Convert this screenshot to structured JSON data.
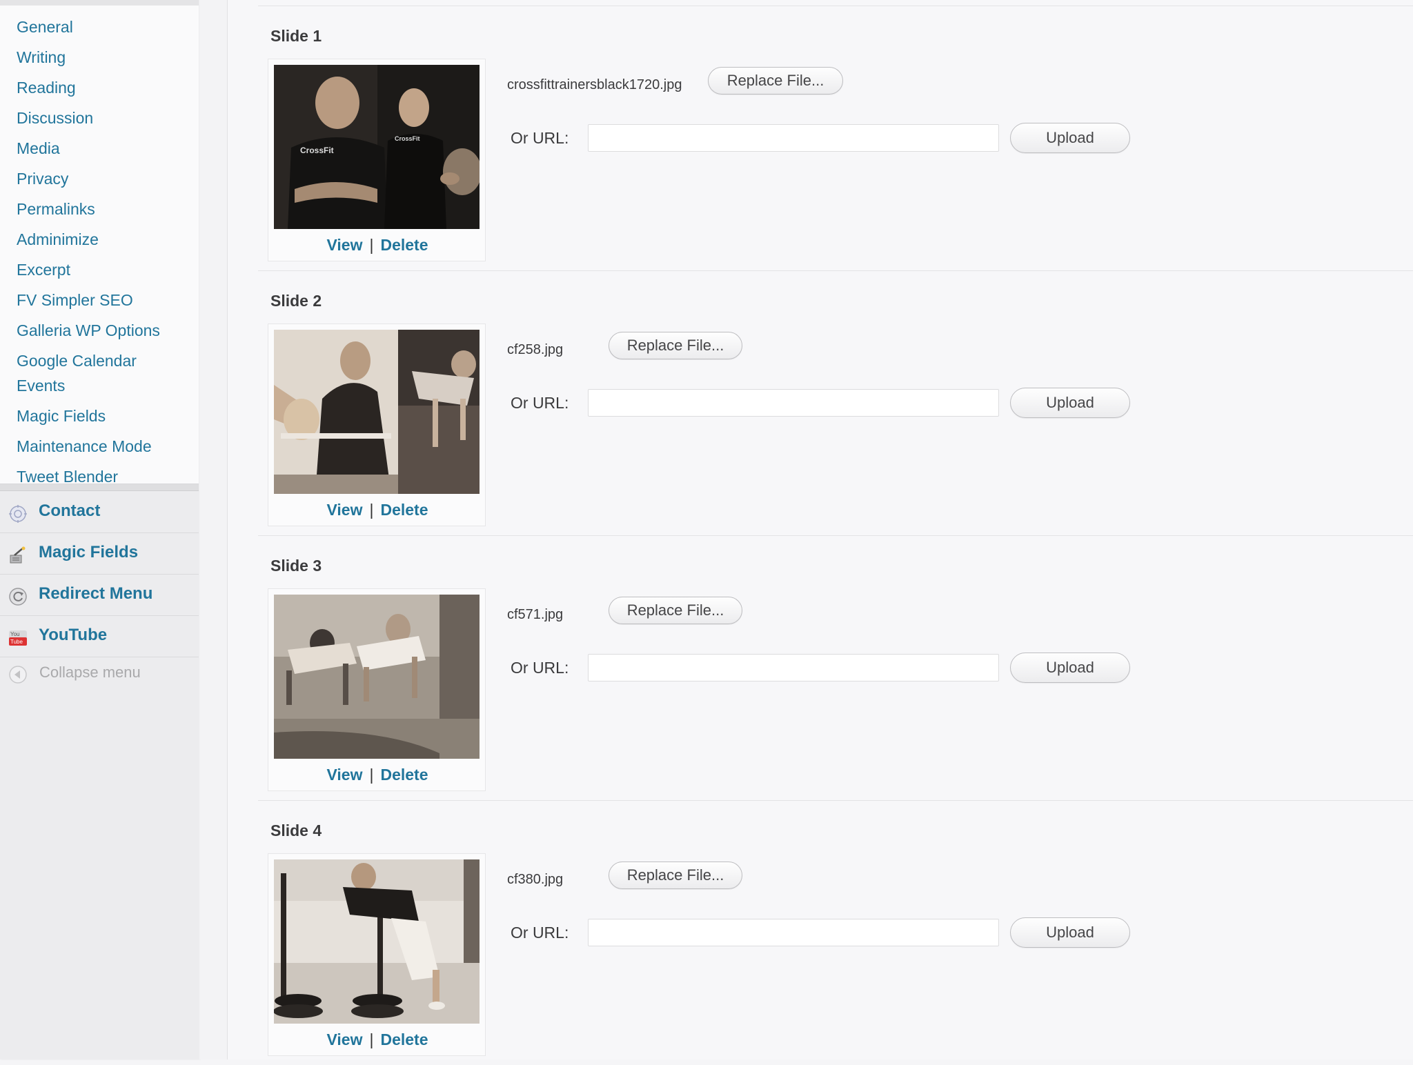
{
  "sidebar": {
    "submenu": [
      "General",
      "Writing",
      "Reading",
      "Discussion",
      "Media",
      "Privacy",
      "Permalinks",
      "Adminimize",
      "Excerpt",
      "FV Simpler SEO",
      "Galleria WP Options",
      "Google Calendar",
      "Events",
      "Magic Fields",
      "Maintenance Mode",
      "Tweet Blender"
    ],
    "menu": [
      {
        "label": "Contact",
        "icon": "contact-icon"
      },
      {
        "label": "Magic Fields",
        "icon": "magic-fields-icon"
      },
      {
        "label": "Redirect Menu",
        "icon": "redirect-icon"
      },
      {
        "label": "YouTube",
        "icon": "youtube-icon"
      }
    ],
    "collapse_label": "Collapse menu"
  },
  "slides": [
    {
      "title": "Slide 1",
      "filename": "crossfittrainersblack1720.jpg",
      "replace_label": "Replace File...",
      "url_label": "Or URL:",
      "url_value": "",
      "upload_label": "Upload",
      "view_label": "View",
      "sep": "|",
      "delete_label": "Delete"
    },
    {
      "title": "Slide 2",
      "filename": "cf258.jpg",
      "replace_label": "Replace File...",
      "url_label": "Or URL:",
      "url_value": "",
      "upload_label": "Upload",
      "view_label": "View",
      "sep": "|",
      "delete_label": "Delete"
    },
    {
      "title": "Slide 3",
      "filename": "cf571.jpg",
      "replace_label": "Replace File...",
      "url_label": "Or URL:",
      "url_value": "",
      "upload_label": "Upload",
      "view_label": "View",
      "sep": "|",
      "delete_label": "Delete"
    },
    {
      "title": "Slide 4",
      "filename": "cf380.jpg",
      "replace_label": "Replace File...",
      "url_label": "Or URL:",
      "url_value": "",
      "upload_label": "Upload",
      "view_label": "View",
      "sep": "|",
      "delete_label": "Delete"
    }
  ],
  "colors": {
    "link": "#21759b",
    "text": "#3b3b3d",
    "background": "#f7f7f9"
  }
}
